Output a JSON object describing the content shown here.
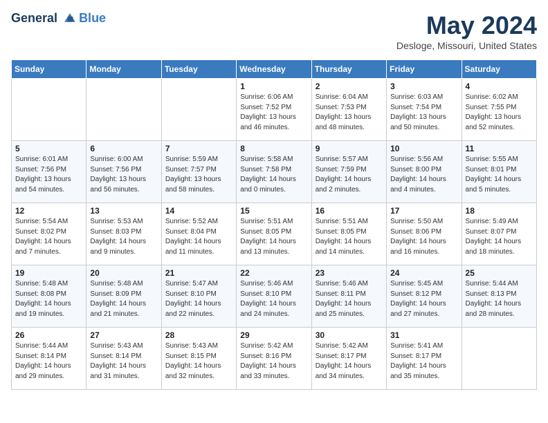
{
  "header": {
    "logo_line1": "General",
    "logo_line2": "Blue",
    "month_title": "May 2024",
    "location": "Desloge, Missouri, United States"
  },
  "days_of_week": [
    "Sunday",
    "Monday",
    "Tuesday",
    "Wednesday",
    "Thursday",
    "Friday",
    "Saturday"
  ],
  "weeks": [
    [
      {
        "day": "",
        "text": ""
      },
      {
        "day": "",
        "text": ""
      },
      {
        "day": "",
        "text": ""
      },
      {
        "day": "1",
        "text": "Sunrise: 6:06 AM\nSunset: 7:52 PM\nDaylight: 13 hours\nand 46 minutes."
      },
      {
        "day": "2",
        "text": "Sunrise: 6:04 AM\nSunset: 7:53 PM\nDaylight: 13 hours\nand 48 minutes."
      },
      {
        "day": "3",
        "text": "Sunrise: 6:03 AM\nSunset: 7:54 PM\nDaylight: 13 hours\nand 50 minutes."
      },
      {
        "day": "4",
        "text": "Sunrise: 6:02 AM\nSunset: 7:55 PM\nDaylight: 13 hours\nand 52 minutes."
      }
    ],
    [
      {
        "day": "5",
        "text": "Sunrise: 6:01 AM\nSunset: 7:56 PM\nDaylight: 13 hours\nand 54 minutes."
      },
      {
        "day": "6",
        "text": "Sunrise: 6:00 AM\nSunset: 7:56 PM\nDaylight: 13 hours\nand 56 minutes."
      },
      {
        "day": "7",
        "text": "Sunrise: 5:59 AM\nSunset: 7:57 PM\nDaylight: 13 hours\nand 58 minutes."
      },
      {
        "day": "8",
        "text": "Sunrise: 5:58 AM\nSunset: 7:58 PM\nDaylight: 14 hours\nand 0 minutes."
      },
      {
        "day": "9",
        "text": "Sunrise: 5:57 AM\nSunset: 7:59 PM\nDaylight: 14 hours\nand 2 minutes."
      },
      {
        "day": "10",
        "text": "Sunrise: 5:56 AM\nSunset: 8:00 PM\nDaylight: 14 hours\nand 4 minutes."
      },
      {
        "day": "11",
        "text": "Sunrise: 5:55 AM\nSunset: 8:01 PM\nDaylight: 14 hours\nand 5 minutes."
      }
    ],
    [
      {
        "day": "12",
        "text": "Sunrise: 5:54 AM\nSunset: 8:02 PM\nDaylight: 14 hours\nand 7 minutes."
      },
      {
        "day": "13",
        "text": "Sunrise: 5:53 AM\nSunset: 8:03 PM\nDaylight: 14 hours\nand 9 minutes."
      },
      {
        "day": "14",
        "text": "Sunrise: 5:52 AM\nSunset: 8:04 PM\nDaylight: 14 hours\nand 11 minutes."
      },
      {
        "day": "15",
        "text": "Sunrise: 5:51 AM\nSunset: 8:05 PM\nDaylight: 14 hours\nand 13 minutes."
      },
      {
        "day": "16",
        "text": "Sunrise: 5:51 AM\nSunset: 8:05 PM\nDaylight: 14 hours\nand 14 minutes."
      },
      {
        "day": "17",
        "text": "Sunrise: 5:50 AM\nSunset: 8:06 PM\nDaylight: 14 hours\nand 16 minutes."
      },
      {
        "day": "18",
        "text": "Sunrise: 5:49 AM\nSunset: 8:07 PM\nDaylight: 14 hours\nand 18 minutes."
      }
    ],
    [
      {
        "day": "19",
        "text": "Sunrise: 5:48 AM\nSunset: 8:08 PM\nDaylight: 14 hours\nand 19 minutes."
      },
      {
        "day": "20",
        "text": "Sunrise: 5:48 AM\nSunset: 8:09 PM\nDaylight: 14 hours\nand 21 minutes."
      },
      {
        "day": "21",
        "text": "Sunrise: 5:47 AM\nSunset: 8:10 PM\nDaylight: 14 hours\nand 22 minutes."
      },
      {
        "day": "22",
        "text": "Sunrise: 5:46 AM\nSunset: 8:10 PM\nDaylight: 14 hours\nand 24 minutes."
      },
      {
        "day": "23",
        "text": "Sunrise: 5:46 AM\nSunset: 8:11 PM\nDaylight: 14 hours\nand 25 minutes."
      },
      {
        "day": "24",
        "text": "Sunrise: 5:45 AM\nSunset: 8:12 PM\nDaylight: 14 hours\nand 27 minutes."
      },
      {
        "day": "25",
        "text": "Sunrise: 5:44 AM\nSunset: 8:13 PM\nDaylight: 14 hours\nand 28 minutes."
      }
    ],
    [
      {
        "day": "26",
        "text": "Sunrise: 5:44 AM\nSunset: 8:14 PM\nDaylight: 14 hours\nand 29 minutes."
      },
      {
        "day": "27",
        "text": "Sunrise: 5:43 AM\nSunset: 8:14 PM\nDaylight: 14 hours\nand 31 minutes."
      },
      {
        "day": "28",
        "text": "Sunrise: 5:43 AM\nSunset: 8:15 PM\nDaylight: 14 hours\nand 32 minutes."
      },
      {
        "day": "29",
        "text": "Sunrise: 5:42 AM\nSunset: 8:16 PM\nDaylight: 14 hours\nand 33 minutes."
      },
      {
        "day": "30",
        "text": "Sunrise: 5:42 AM\nSunset: 8:17 PM\nDaylight: 14 hours\nand 34 minutes."
      },
      {
        "day": "31",
        "text": "Sunrise: 5:41 AM\nSunset: 8:17 PM\nDaylight: 14 hours\nand 35 minutes."
      },
      {
        "day": "",
        "text": ""
      }
    ]
  ]
}
